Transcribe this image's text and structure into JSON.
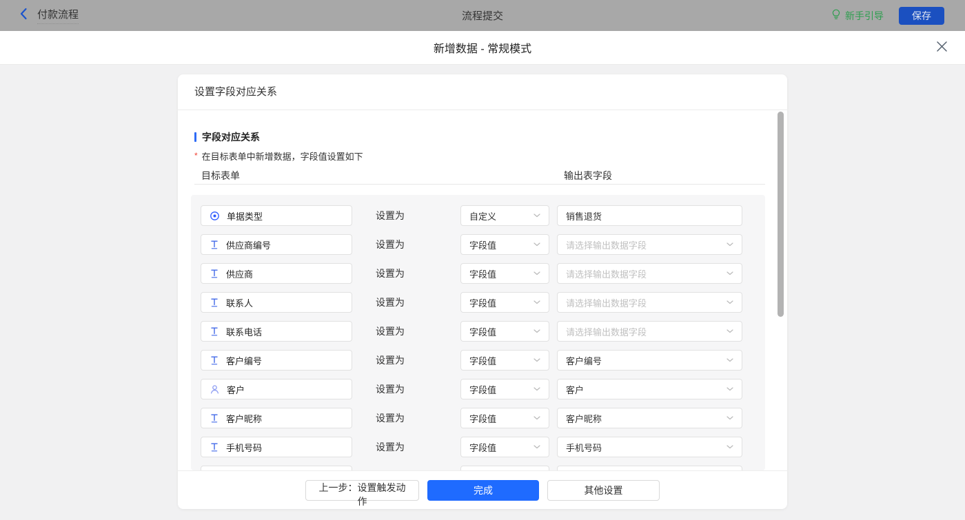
{
  "topbar": {
    "back_label": "付款流程",
    "center_title": "流程提交",
    "guide_label": "新手引导",
    "save_label": "保存"
  },
  "modal": {
    "title": "新增数据 - 常规模式"
  },
  "card": {
    "header": "设置字段对应关系",
    "section_title": "字段对应关系",
    "section_note": "在目标表单中新增数据，字段值设置如下",
    "col_target": "目标表单",
    "col_output": "输出表字段",
    "set_as_label": "设置为",
    "output_placeholder": "请选择输出数据字段"
  },
  "rows": [
    {
      "icon": "radio",
      "field": "单据类型",
      "mode": "自定义",
      "output": {
        "kind": "input",
        "value": "销售退货",
        "placeholder": false
      }
    },
    {
      "icon": "text",
      "field": "供应商编号",
      "mode": "字段值",
      "output": {
        "kind": "select",
        "value": "请选择输出数据字段",
        "placeholder": true
      }
    },
    {
      "icon": "text",
      "field": "供应商",
      "mode": "字段值",
      "output": {
        "kind": "select",
        "value": "请选择输出数据字段",
        "placeholder": true
      }
    },
    {
      "icon": "text",
      "field": "联系人",
      "mode": "字段值",
      "output": {
        "kind": "select",
        "value": "请选择输出数据字段",
        "placeholder": true
      }
    },
    {
      "icon": "text",
      "field": "联系电话",
      "mode": "字段值",
      "output": {
        "kind": "select",
        "value": "请选择输出数据字段",
        "placeholder": true
      }
    },
    {
      "icon": "text",
      "field": "客户编号",
      "mode": "字段值",
      "output": {
        "kind": "select",
        "value": "客户编号",
        "placeholder": false
      }
    },
    {
      "icon": "person",
      "field": "客户",
      "mode": "字段值",
      "output": {
        "kind": "select",
        "value": "客户",
        "placeholder": false
      }
    },
    {
      "icon": "text",
      "field": "客户昵称",
      "mode": "字段值",
      "output": {
        "kind": "select",
        "value": "客户昵称",
        "placeholder": false
      }
    },
    {
      "icon": "text",
      "field": "手机号码",
      "mode": "字段值",
      "output": {
        "kind": "select",
        "value": "手机号码",
        "placeholder": false
      }
    },
    {
      "icon": "",
      "field": "",
      "mode": "",
      "output": {
        "kind": "select",
        "value": "",
        "placeholder": false
      },
      "partial": true
    }
  ],
  "footer": {
    "prev_label": "上一步：设置触发动作",
    "done_label": "完成",
    "other_label": "其他设置"
  },
  "colors": {
    "accent_blue": "#1f6bff",
    "dimmed_save_blue": "#1b50c0",
    "guide_green": "#2e9e4f",
    "field_icon_blue": "#4168e8",
    "person_icon_blue": "#8b9bf3",
    "section_bar_blue": "#2e6bf6",
    "asterisk_red": "#f04134",
    "topbar_bg": "#a8a8a8",
    "panel_bg": "#f6f6f7",
    "scrollbar": "#b3b3b3"
  }
}
